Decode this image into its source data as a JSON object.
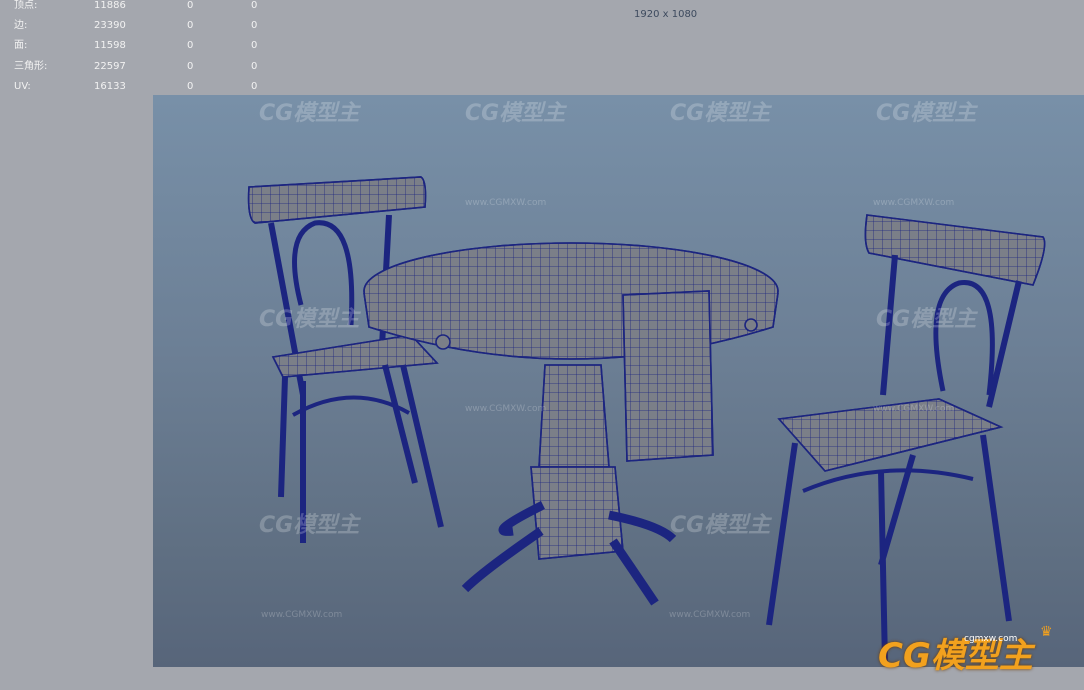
{
  "stats": [
    {
      "label": "顶点:",
      "v1": "11886",
      "v2": "0",
      "v3": "0"
    },
    {
      "label": "边:",
      "v1": "23390",
      "v2": "0",
      "v3": "0"
    },
    {
      "label": "面:",
      "v1": "11598",
      "v2": "0",
      "v3": "0"
    },
    {
      "label": "三角形:",
      "v1": "22597",
      "v2": "0",
      "v3": "0"
    },
    {
      "label": "UV:",
      "v1": "16133",
      "v2": "0",
      "v3": "0"
    }
  ],
  "resolution": "1920 x 1080",
  "watermark": {
    "brand": "CG模型主",
    "url": "www.CGMXW.com"
  },
  "logo": {
    "text": "CG模型主",
    "url": "cgmxw.com"
  },
  "colors": {
    "wire": "#1c2580",
    "viewport_top": "#7890a8",
    "viewport_bottom": "#57657a",
    "logo": "#f2a11e"
  }
}
